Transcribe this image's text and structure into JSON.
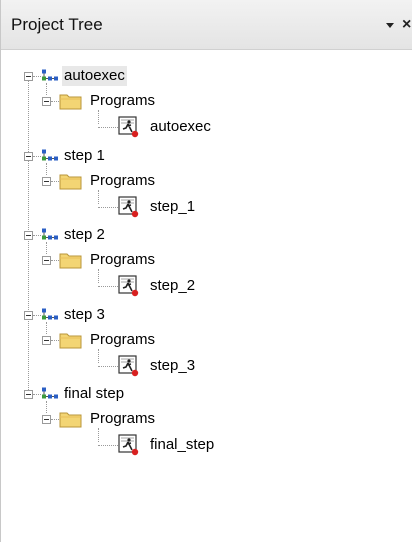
{
  "panel": {
    "title": "Project Tree",
    "pin_icon": "dropdown-arrow-icon",
    "close_icon": "close-icon"
  },
  "tree": {
    "tasks": [
      {
        "name": "autoexec",
        "folder": "Programs",
        "program": "autoexec",
        "selected": true
      },
      {
        "name": "step 1",
        "folder": "Programs",
        "program": "step_1",
        "selected": false
      },
      {
        "name": "step 2",
        "folder": "Programs",
        "program": "step_2",
        "selected": false
      },
      {
        "name": "step 3",
        "folder": "Programs",
        "program": "step_3",
        "selected": false
      },
      {
        "name": "final step",
        "folder": "Programs",
        "program": "final_step",
        "selected": false
      }
    ]
  },
  "icons": {
    "task": "task-network-icon",
    "folder": "folder-icon",
    "program": "program-runner-icon"
  },
  "colors": {
    "task_icon_blue": "#2b5fc4",
    "task_icon_green": "#3c9a3c",
    "folder_yellow": "#f3d574",
    "program_red": "#d82020"
  }
}
